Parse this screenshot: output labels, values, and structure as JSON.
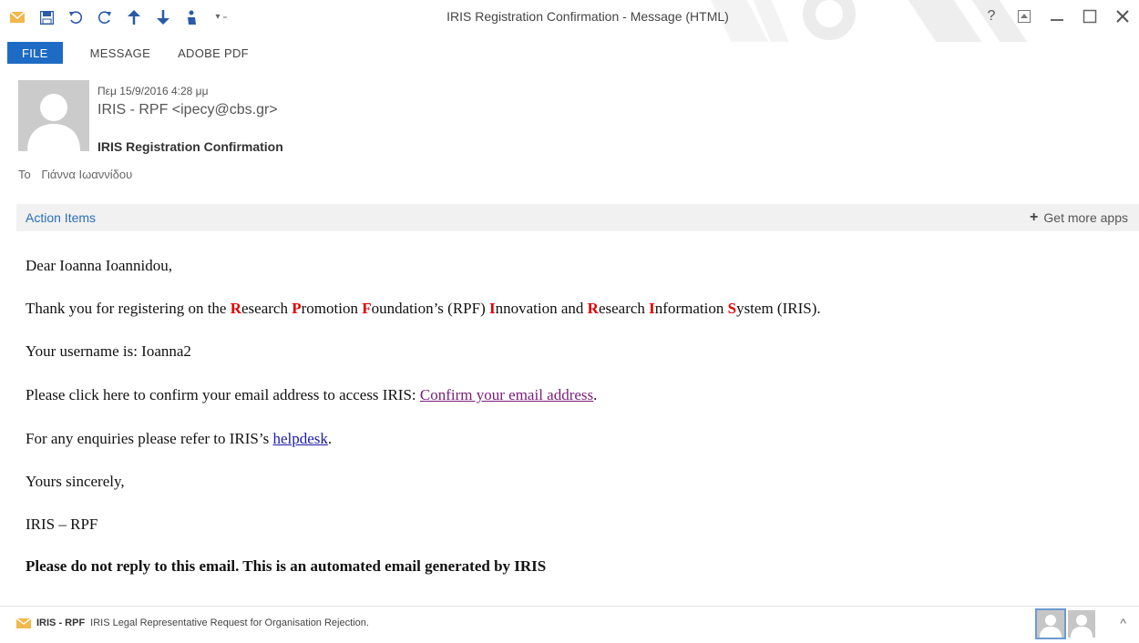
{
  "window": {
    "title": "IRIS Registration Confirmation - Message (HTML)"
  },
  "quick_access": [
    {
      "name": "mail-app-icon",
      "glyph": "✉"
    },
    {
      "name": "save-icon",
      "glyph": "💾"
    },
    {
      "name": "undo-icon",
      "glyph": "↶"
    },
    {
      "name": "redo-icon",
      "glyph": "↷"
    },
    {
      "name": "previous-item-icon",
      "glyph": "↑"
    },
    {
      "name": "next-item-icon",
      "glyph": "↓"
    },
    {
      "name": "touch-mode-icon",
      "glyph": "☝"
    },
    {
      "name": "customize-qat-icon",
      "glyph": "▾"
    }
  ],
  "window_controls": {
    "help": "?",
    "ribbon_options": "⬆",
    "minimize": "—",
    "maximize": "☐",
    "close": "✕"
  },
  "ribbon": {
    "tabs": [
      "FILE",
      "MESSAGE",
      "ADOBE PDF"
    ]
  },
  "header": {
    "date": "Πεμ 15/9/2016 4:28 μμ",
    "sender": "IRIS - RPF <ipecy@cbs.gr>",
    "subject": "IRIS Registration Confirmation",
    "to_label": "To",
    "to_value": "Γιάννα Ιωαννίδου"
  },
  "action_bar": {
    "action_items": "Action Items",
    "get_more_apps": "Get more apps",
    "plus": "+"
  },
  "body": {
    "greeting": "Dear Ioanna Ioannidou,",
    "thanks": {
      "intro": "Thank you for registering on the ",
      "r1": "R",
      "t1": "esearch ",
      "p1": "P",
      "t2": "romotion ",
      "f1": "F",
      "t3": "oundation’s (RPF) ",
      "i1": "I",
      "t4": "nnovation and ",
      "r2": "R",
      "t5": "esearch ",
      "i2": "I",
      "t6": "nformation ",
      "s1": "S",
      "t7": "ystem (IRIS)."
    },
    "username": "Your username is: Ioanna2",
    "confirm_prefix": "Please click here to confirm your email address to access IRIS: ",
    "confirm_link": "Confirm your email address",
    "confirm_suffix": ".",
    "enquiries_prefix": "For any enquiries please refer to IRIS’s ",
    "helpdesk_link": "helpdesk",
    "enquiries_suffix": ".",
    "closing": "Yours sincerely,",
    "signature": "IRIS – RPF",
    "notice": "Please do not reply to this email. This is an automated email generated by IRIS"
  },
  "people_pane": {
    "sender": "IRIS - RPF",
    "subject": "IRIS Legal Representative Request for Organisation Rejection.",
    "chevron": "^"
  },
  "colors": {
    "file_tab": "#1e6bc5",
    "link_visited": "#7a1c7a",
    "link": "#1a1aa8",
    "acronym_red": "#e00000",
    "action_link": "#2a6ebb"
  }
}
